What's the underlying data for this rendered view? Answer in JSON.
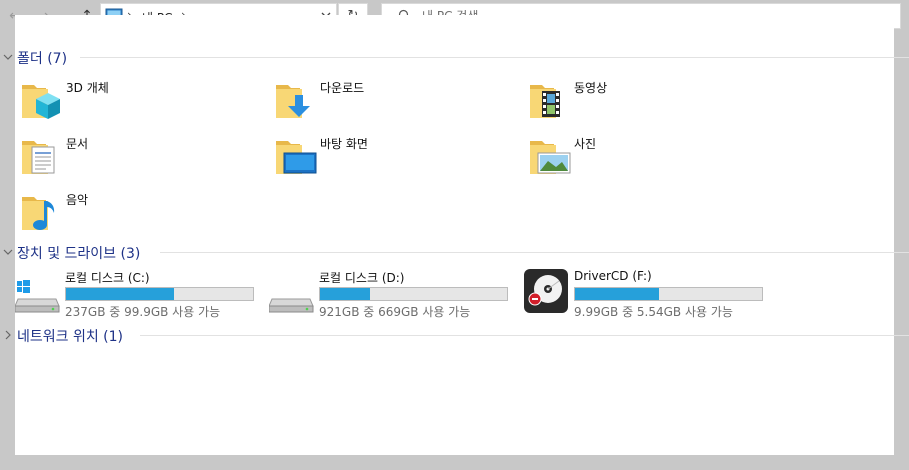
{
  "address": {
    "breadcrumb": "내 PC",
    "separator": "›"
  },
  "search": {
    "placeholder": "내 PC 검색"
  },
  "sections": {
    "folders": {
      "title": "폴더 (7)",
      "items": [
        {
          "label": "3D 개체"
        },
        {
          "label": "다운로드"
        },
        {
          "label": "동영상"
        },
        {
          "label": "문서"
        },
        {
          "label": "바탕 화면"
        },
        {
          "label": "사진"
        },
        {
          "label": "음악"
        }
      ]
    },
    "devices": {
      "title": "장치 및 드라이브 (3)",
      "items": [
        {
          "name": "로컬 디스크 (C:)",
          "size_text": "237GB 중 99.9GB 사용 가능",
          "used_fraction": 0.58
        },
        {
          "name": "로컬 디스크 (D:)",
          "size_text": "921GB 중 669GB 사용 가능",
          "used_fraction": 0.27
        },
        {
          "name": "DriverCD (F:)",
          "size_text": "9.99GB 중 5.54GB 사용 가능",
          "used_fraction": 0.45
        }
      ]
    },
    "network": {
      "title": "네트워크 위치 (1)"
    }
  },
  "colors": {
    "section_title": "#1e3287",
    "bar_fill": "#26a0da",
    "folder_yellow": "#f8d775"
  }
}
